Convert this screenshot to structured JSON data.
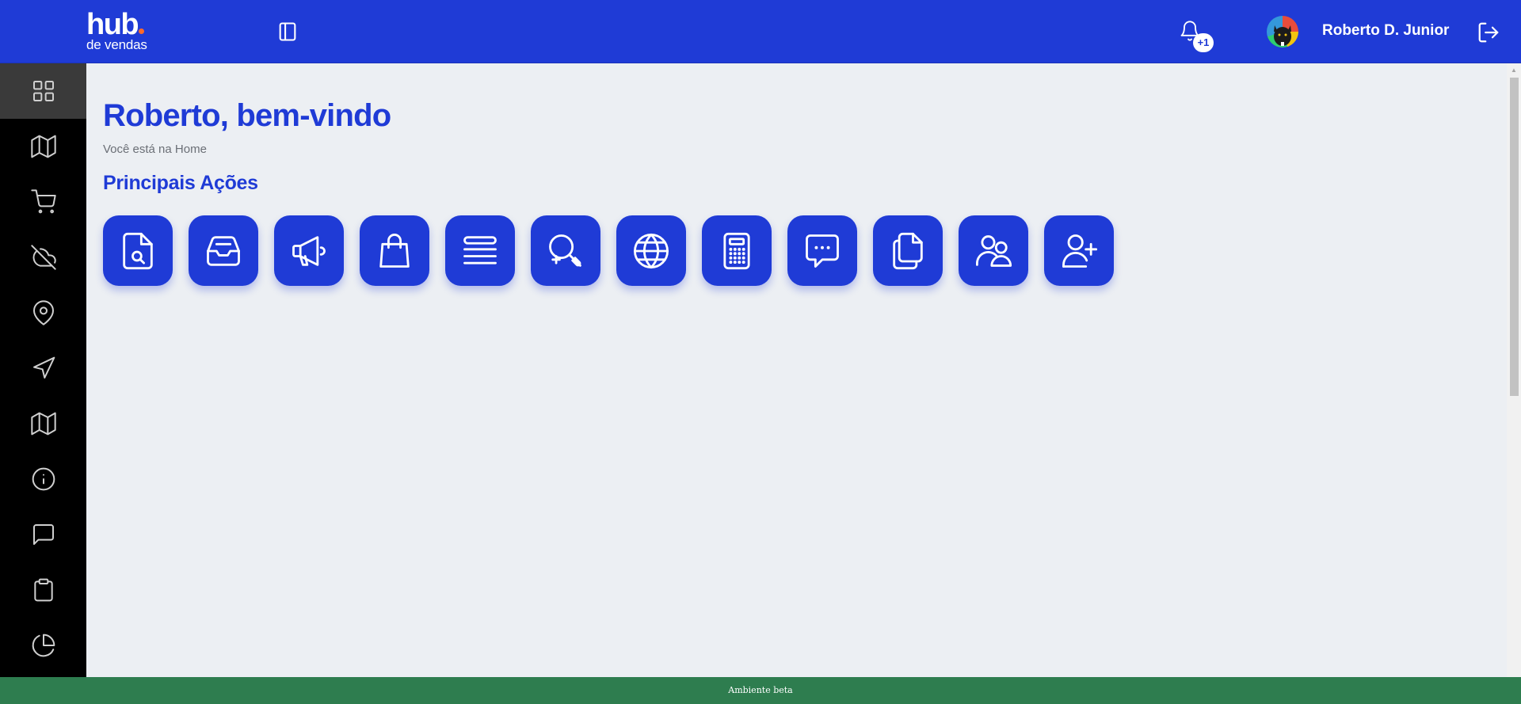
{
  "header": {
    "logo_main": "hub",
    "logo_sub": "de vendas",
    "brand_color": "#1f3bd6",
    "logo_dot_color": "#ff6a2a",
    "notification_badge": "+1",
    "user_name": "Roberto D. Junior"
  },
  "sidebar": {
    "items": [
      {
        "icon": "grid-icon",
        "active": true
      },
      {
        "icon": "map-icon",
        "active": false
      },
      {
        "icon": "cart-icon",
        "active": false
      },
      {
        "icon": "cloud-off-icon",
        "active": false
      },
      {
        "icon": "map-pin-icon",
        "active": false
      },
      {
        "icon": "navigation-icon",
        "active": false
      },
      {
        "icon": "map-icon",
        "active": false
      },
      {
        "icon": "info-icon",
        "active": false
      },
      {
        "icon": "message-square-icon",
        "active": false
      },
      {
        "icon": "clipboard-icon",
        "active": false
      },
      {
        "icon": "pie-chart-icon",
        "active": false
      }
    ]
  },
  "main": {
    "title": "Roberto, bem-vindo",
    "subtitle": "Você está na Home",
    "section_title": "Principais Ações",
    "actions": [
      {
        "icon": "file-search-icon"
      },
      {
        "icon": "inbox-icon"
      },
      {
        "icon": "megaphone-icon"
      },
      {
        "icon": "shopping-bag-icon"
      },
      {
        "icon": "list-icon"
      },
      {
        "icon": "search-plus-icon"
      },
      {
        "icon": "globe-icon"
      },
      {
        "icon": "calculator-icon"
      },
      {
        "icon": "chat-icon"
      },
      {
        "icon": "copy-icon"
      },
      {
        "icon": "users-icon"
      },
      {
        "icon": "user-plus-icon"
      }
    ]
  },
  "footer": {
    "text": "Ambiente beta",
    "color": "#2e7d4f"
  }
}
